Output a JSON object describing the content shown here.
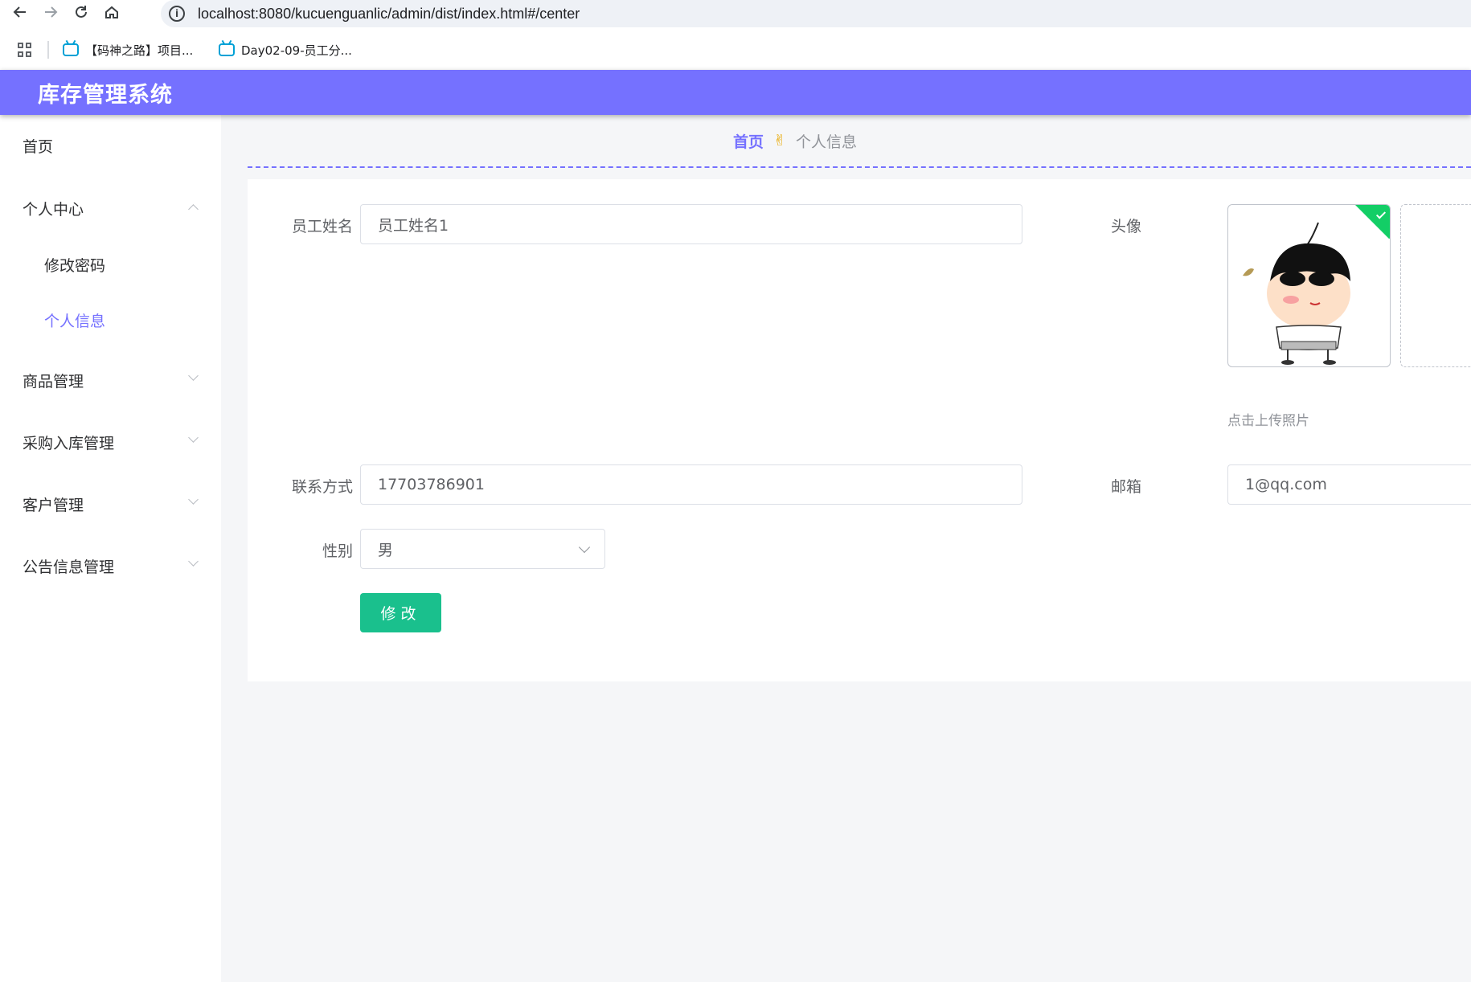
{
  "browser": {
    "url": "localhost:8080/kucuenguanlic/admin/dist/index.html#/center",
    "nav_icons": [
      "back-arrow-icon",
      "forward-arrow-icon",
      "reload-icon",
      "home-icon"
    ],
    "bookmarks": [
      {
        "label": "【码神之路】项目...",
        "icon": "bilibili-tv-icon"
      },
      {
        "label": "Day02-09-员工分...",
        "icon": "bilibili-tv-icon"
      }
    ]
  },
  "app": {
    "title": "库存管理系统",
    "accent_color": "#7571ff"
  },
  "sidebar": {
    "items": [
      {
        "label": "首页"
      },
      {
        "label": "个人中心",
        "expanded": true
      },
      {
        "label": "修改密码"
      },
      {
        "label": "个人信息",
        "active": true
      },
      {
        "label": "商品管理"
      },
      {
        "label": "采购入库管理"
      },
      {
        "label": "客户管理"
      },
      {
        "label": "公告信息管理"
      }
    ]
  },
  "breadcrumb": {
    "home": "首页",
    "separator_icon": "hand-icon",
    "current": "个人信息"
  },
  "form": {
    "name_label": "员工姓名",
    "name_value": "员工姓名1",
    "avatar_label": "头像",
    "upload_hint": "点击上传照片",
    "phone_label": "联系方式",
    "phone_value": "17703786901",
    "email_label": "邮箱",
    "email_value": "1@qq.com",
    "gender_label": "性别",
    "gender_value": "男",
    "submit_label": "修改"
  }
}
